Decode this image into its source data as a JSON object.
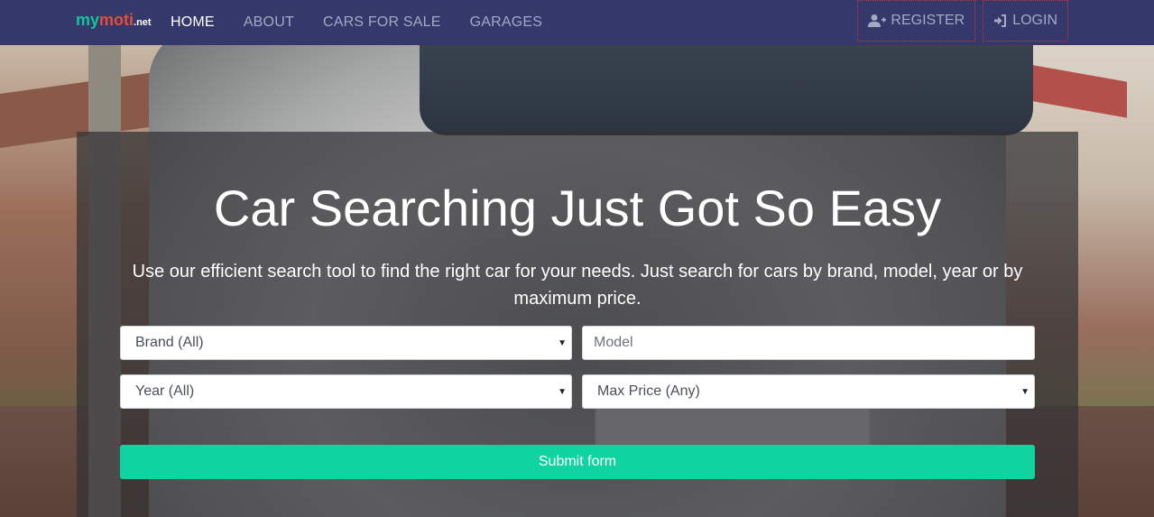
{
  "nav": {
    "brand": {
      "part1": "my",
      "part2": "moti",
      "part3": ".net"
    },
    "links": [
      {
        "label": "HOME"
      },
      {
        "label": "ABOUT"
      },
      {
        "label": "CARS FOR SALE"
      },
      {
        "label": "GARAGES"
      }
    ],
    "register_label": "REGISTER",
    "login_label": "LOGIN"
  },
  "hero": {
    "headline": "Car Searching Just Got So Easy",
    "subtext": "Use our efficient search tool to find the right car for your needs. Just search for cars by brand, model, year or by maximum price."
  },
  "search": {
    "brand_value": "Brand (All)",
    "model_placeholder": "Model",
    "year_value": "Year (All)",
    "price_value": "Max Price (Any)",
    "submit_label": "Submit form"
  },
  "colors": {
    "navbar": "#35386a",
    "accent": "#0fd3a0",
    "nav_active": "#ffffff",
    "nav_inactive": "#a3a9c4"
  },
  "icons": {
    "register": "user-plus-icon",
    "login": "sign-in-icon",
    "dropdown": "caret-down-icon"
  }
}
